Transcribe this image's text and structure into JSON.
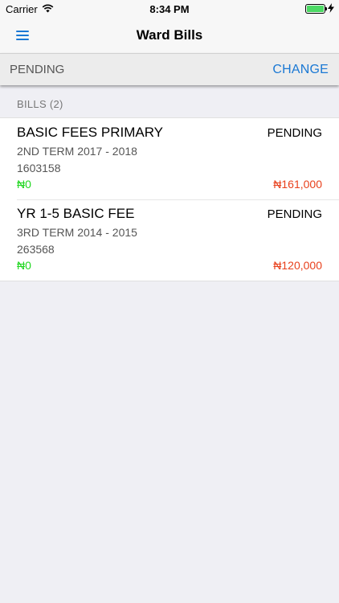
{
  "status_bar": {
    "carrier": "Carrier",
    "time": "8:34 PM",
    "icons": [
      "wifi-icon",
      "battery-icon",
      "charging-icon"
    ]
  },
  "nav": {
    "title": "Ward Bills",
    "menu_icon": "hamburger-menu-icon"
  },
  "filter": {
    "label": "PENDING",
    "change_label": "CHANGE"
  },
  "bills": {
    "header": "BILLS (2)",
    "items": [
      {
        "name": "BASIC FEES PRIMARY",
        "status": "PENDING",
        "term": "2ND TERM 2017 - 2018",
        "number": "1603158",
        "paid": "₦0",
        "amount": "₦161,000"
      },
      {
        "name": "YR 1-5 BASIC FEE",
        "status": "PENDING",
        "term": "3RD TERM 2014 - 2015",
        "number": "263568",
        "paid": "₦0",
        "amount": "₦120,000"
      }
    ]
  },
  "colors": {
    "accent": "#1a78d4",
    "paid": "#1fd61f",
    "due": "#e8401c",
    "background": "#efeff4"
  }
}
